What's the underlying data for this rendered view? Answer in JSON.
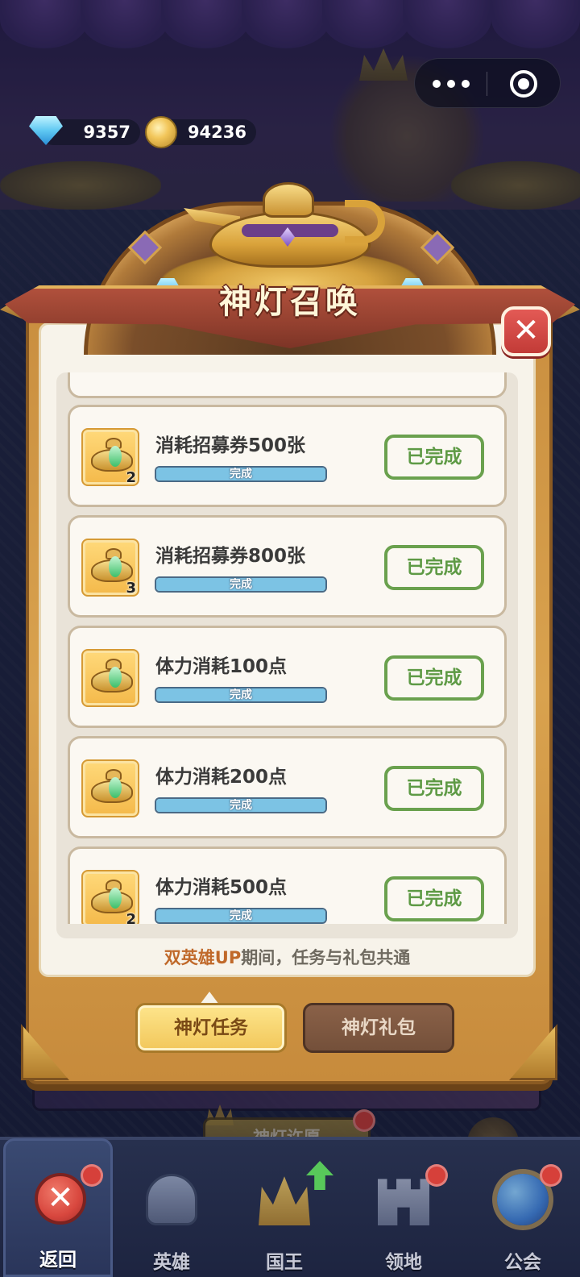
{
  "currency": {
    "gems": "9357",
    "gold": "94236",
    "gem_icon": "diamond-icon",
    "gold_icon": "gold-coin-icon"
  },
  "capsule": {
    "more_icon": "more-dots-icon",
    "close_icon": "target-circle-icon"
  },
  "modal": {
    "title": "神灯召唤",
    "close_icon": "close-icon",
    "tasks": [
      {
        "name": "消耗招募券500张",
        "reward_qty": "2",
        "progress_label": "完成",
        "progress": 1.0,
        "status": "已完成"
      },
      {
        "name": "消耗招募券800张",
        "reward_qty": "3",
        "progress_label": "完成",
        "progress": 1.0,
        "status": "已完成"
      },
      {
        "name": "体力消耗100点",
        "reward_qty": "",
        "progress_label": "完成",
        "progress": 1.0,
        "status": "已完成"
      },
      {
        "name": "体力消耗200点",
        "reward_qty": "",
        "progress_label": "完成",
        "progress": 1.0,
        "status": "已完成"
      },
      {
        "name": "体力消耗500点",
        "reward_qty": "2",
        "progress_label": "完成",
        "progress": 1.0,
        "status": "已完成"
      }
    ],
    "notice_highlight": "双英雄UP",
    "notice_rest": "期间，任务与礼包共通",
    "tabs": {
      "active": "神灯任务",
      "inactive": "神灯礼包"
    }
  },
  "background": {
    "wish_button": "神灯许愿"
  },
  "nav": {
    "items": [
      {
        "label": "返回",
        "icon": "close-x-icon"
      },
      {
        "label": "英雄",
        "icon": "helmet-icon"
      },
      {
        "label": "国王",
        "icon": "crown-icon"
      },
      {
        "label": "领地",
        "icon": "castle-icon"
      },
      {
        "label": "公会",
        "icon": "planet-icon"
      }
    ]
  },
  "colors": {
    "accent_gold": "#f2c75a",
    "ribbon_red": "#93402f",
    "done_green": "#5e9a45",
    "progress_blue": "#7cc3e4",
    "notice_orange": "#c0692a",
    "badge_red": "#d6403a"
  }
}
